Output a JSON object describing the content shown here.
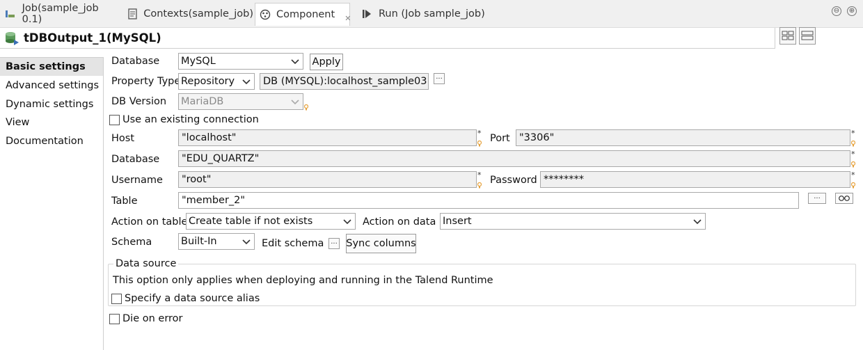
{
  "tabs": [
    {
      "label": "Job(sample_job 0.1)",
      "icon": "job-icon"
    },
    {
      "label": "Contexts(sample_job)",
      "icon": "contexts-icon"
    },
    {
      "label": "Component",
      "icon": "component-icon",
      "active": true
    },
    {
      "label": "Run (Job sample_job)",
      "icon": "run-icon"
    }
  ],
  "window_controls": {
    "minimize": "⊖",
    "maximize": "⊕"
  },
  "title": "tDBOutput_1(MySQL)",
  "sidenav": [
    {
      "label": "Basic settings",
      "active": true
    },
    {
      "label": "Advanced settings"
    },
    {
      "label": "Dynamic settings"
    },
    {
      "label": "View"
    },
    {
      "label": "Documentation"
    }
  ],
  "form": {
    "database_label": "Database",
    "database_value": "MySQL",
    "apply_label": "Apply",
    "property_type_label": "Property Type",
    "property_type_value": "Repository",
    "repository_value": "DB (MYSQL):localhost_sample03",
    "db_version_label": "DB Version",
    "db_version_value": "MariaDB",
    "use_existing_label": "Use an existing connection",
    "use_existing_checked": false,
    "host_label": "Host",
    "host_value": "\"localhost\"",
    "port_label": "Port",
    "port_value": "\"3306\"",
    "database2_label": "Database",
    "database2_value": "\"EDU_QUARTZ\"",
    "username_label": "Username",
    "username_value": "\"root\"",
    "password_label": "Password",
    "password_value": "********",
    "table_label": "Table",
    "table_value": "\"member_2\"",
    "action_table_label": "Action on table",
    "action_table_value": "Create table if not exists",
    "action_data_label": "Action on data",
    "action_data_value": "Insert",
    "schema_label": "Schema",
    "schema_value": "Built-In",
    "edit_schema_label": "Edit schema",
    "sync_columns_label": "Sync columns",
    "datasource_legend": "Data source",
    "datasource_note": "This option only applies when deploying and running in the Talend Runtime",
    "datasource_alias_label": "Specify a data source alias",
    "die_on_error_label": "Die on error",
    "ellipsis": "···",
    "required_mark": "*"
  },
  "colors": {
    "accent_green": "#3d8f3d",
    "bulb": "#e6a23c",
    "border": "#a9a9a9"
  }
}
